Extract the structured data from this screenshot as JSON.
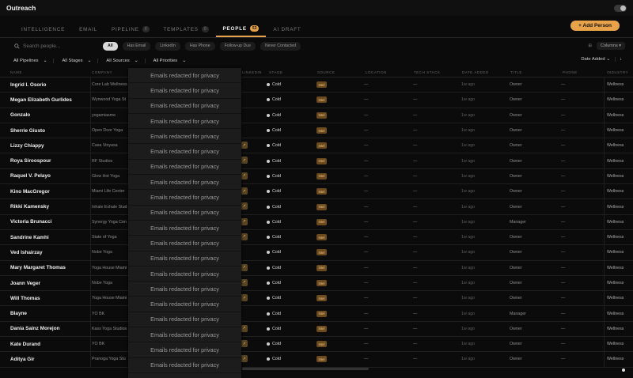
{
  "app": {
    "title": "Outreach"
  },
  "tabs": [
    {
      "label": "INTELLIGENCE",
      "count": ""
    },
    {
      "label": "EMAIL",
      "count": ""
    },
    {
      "label": "PIPELINE",
      "count": "0"
    },
    {
      "label": "TEMPLATES",
      "count": "0"
    },
    {
      "label": "PEOPLE",
      "count": "53"
    },
    {
      "label": "AI DRAFT",
      "count": ""
    }
  ],
  "add_button": "+ Add Person",
  "search": {
    "placeholder": "Search people..."
  },
  "chips": [
    "All",
    "Has Email",
    "LinkedIn",
    "Has Phone",
    "Follow-up Due",
    "Never Contacted"
  ],
  "columns_button": "Columns",
  "filters": {
    "pipelines": "All Pipelines",
    "stages": "All Stages",
    "sources": "All Sources",
    "priorities": "All Priorities"
  },
  "sort": {
    "label": "Date Added"
  },
  "headers": {
    "name": "NAME",
    "company": "COMPANY",
    "linkedin": "LINKEDIN",
    "stage": "STAGE",
    "source": "SOURCE",
    "location": "LOCATION",
    "tech": "TECH STACK",
    "date": "DATE ADDED",
    "title": "TITLE",
    "phone": "PHONE",
    "industry": "INDUSTRY"
  },
  "redaction_text": "Emails redacted for privacy",
  "rows": [
    {
      "name": "Ingrid I. Osorio",
      "company": "Core Lab Wellness",
      "stage": "Cold",
      "source": "Intel",
      "loc": "—",
      "tech": "—",
      "date": "1w ago",
      "title": "Owner",
      "phone": "—",
      "industry": "Wellness",
      "linked": false
    },
    {
      "name": "Megan Elizabeth Gurlides",
      "company": "Wynwood Yoga St",
      "stage": "Cold",
      "source": "Intel",
      "loc": "—",
      "tech": "—",
      "date": "1w ago",
      "title": "Owner",
      "phone": "—",
      "industry": "Wellness",
      "linked": false
    },
    {
      "name": "Gonzalo",
      "company": "yogamiasme",
      "stage": "Cold",
      "source": "Intel",
      "loc": "—",
      "tech": "—",
      "date": "1w ago",
      "title": "Owner",
      "phone": "—",
      "industry": "Wellness",
      "linked": false
    },
    {
      "name": "Sherrie Giusto",
      "company": "Open Door Yoga",
      "stage": "Cold",
      "source": "Intel",
      "loc": "—",
      "tech": "—",
      "date": "1w ago",
      "title": "Owner",
      "phone": "—",
      "industry": "Wellness",
      "linked": false
    },
    {
      "name": "Lizzy Chiappy",
      "company": "Casa Vinyasa",
      "stage": "Cold",
      "source": "Intel",
      "loc": "—",
      "tech": "—",
      "date": "1w ago",
      "title": "Owner",
      "phone": "—",
      "industry": "Wellness",
      "linked": true
    },
    {
      "name": "Roya Siroospour",
      "company": "RF Studios",
      "stage": "Cold",
      "source": "Intel",
      "loc": "—",
      "tech": "—",
      "date": "1w ago",
      "title": "Owner",
      "phone": "—",
      "industry": "Wellness",
      "linked": true
    },
    {
      "name": "Raquel V. Pelayo",
      "company": "Glow Hot Yoga",
      "stage": "Cold",
      "source": "Intel",
      "loc": "—",
      "tech": "—",
      "date": "1w ago",
      "title": "Owner",
      "phone": "—",
      "industry": "Wellness",
      "linked": true
    },
    {
      "name": "Kino MacGregor",
      "company": "Miami Life Center",
      "stage": "Cold",
      "source": "Intel",
      "loc": "—",
      "tech": "—",
      "date": "1w ago",
      "title": "Owner",
      "phone": "—",
      "industry": "Wellness",
      "linked": true
    },
    {
      "name": "Rikki Kamensky",
      "company": "Inhale Exhale Stud",
      "stage": "Cold",
      "source": "Intel",
      "loc": "—",
      "tech": "—",
      "date": "1w ago",
      "title": "Owner",
      "phone": "—",
      "industry": "Wellness",
      "linked": true
    },
    {
      "name": "Victoria Brunacci",
      "company": "Synergy Yoga Cen",
      "stage": "Cold",
      "source": "Intel",
      "loc": "—",
      "tech": "—",
      "date": "1w ago",
      "title": "Manager",
      "phone": "—",
      "industry": "Wellness",
      "linked": true
    },
    {
      "name": "Sandrine Kamhi",
      "company": "State of Yoga",
      "stage": "Cold",
      "source": "Intel",
      "loc": "—",
      "tech": "—",
      "date": "1w ago",
      "title": "Owner",
      "phone": "—",
      "industry": "Wellness",
      "linked": true
    },
    {
      "name": "Ved Ishairzay",
      "company": "Nobe Yoga",
      "stage": "Cold",
      "source": "Intel",
      "loc": "—",
      "tech": "—",
      "date": "1w ago",
      "title": "Owner",
      "phone": "—",
      "industry": "Wellness",
      "linked": false
    },
    {
      "name": "Mary Margaret Thomas",
      "company": "Yoga House Miami",
      "stage": "Cold",
      "source": "Intel",
      "loc": "—",
      "tech": "—",
      "date": "1w ago",
      "title": "Owner",
      "phone": "—",
      "industry": "Wellness",
      "linked": true
    },
    {
      "name": "Joann Veger",
      "company": "Nobe Yoga",
      "stage": "Cold",
      "source": "Intel",
      "loc": "—",
      "tech": "—",
      "date": "1w ago",
      "title": "Owner",
      "phone": "—",
      "industry": "Wellness",
      "linked": true
    },
    {
      "name": "Will Thomas",
      "company": "Yoga House Miami",
      "stage": "Cold",
      "source": "Intel",
      "loc": "—",
      "tech": "—",
      "date": "1w ago",
      "title": "Owner",
      "phone": "—",
      "industry": "Wellness",
      "linked": true
    },
    {
      "name": "Blayne",
      "company": "YO BK",
      "stage": "Cold",
      "source": "Intel",
      "loc": "—",
      "tech": "—",
      "date": "1w ago",
      "title": "Manager",
      "phone": "—",
      "industry": "Wellness",
      "linked": false
    },
    {
      "name": "Dania Sainz Morejon",
      "company": "Kass Yoga Studios",
      "stage": "Cold",
      "source": "Intel",
      "loc": "—",
      "tech": "—",
      "date": "1w ago",
      "title": "Owner",
      "phone": "—",
      "industry": "Wellness",
      "linked": true
    },
    {
      "name": "Kate Durand",
      "company": "YO BK",
      "stage": "Cold",
      "source": "Intel",
      "loc": "—",
      "tech": "—",
      "date": "1w ago",
      "title": "Owner",
      "phone": "—",
      "industry": "Wellness",
      "linked": true
    },
    {
      "name": "Aditya Gir",
      "company": "Pranoga Yoga Stu",
      "stage": "Cold",
      "source": "Intel",
      "loc": "—",
      "tech": "—",
      "date": "1w ago",
      "title": "Owner",
      "phone": "—",
      "industry": "Wellness",
      "linked": true
    }
  ]
}
